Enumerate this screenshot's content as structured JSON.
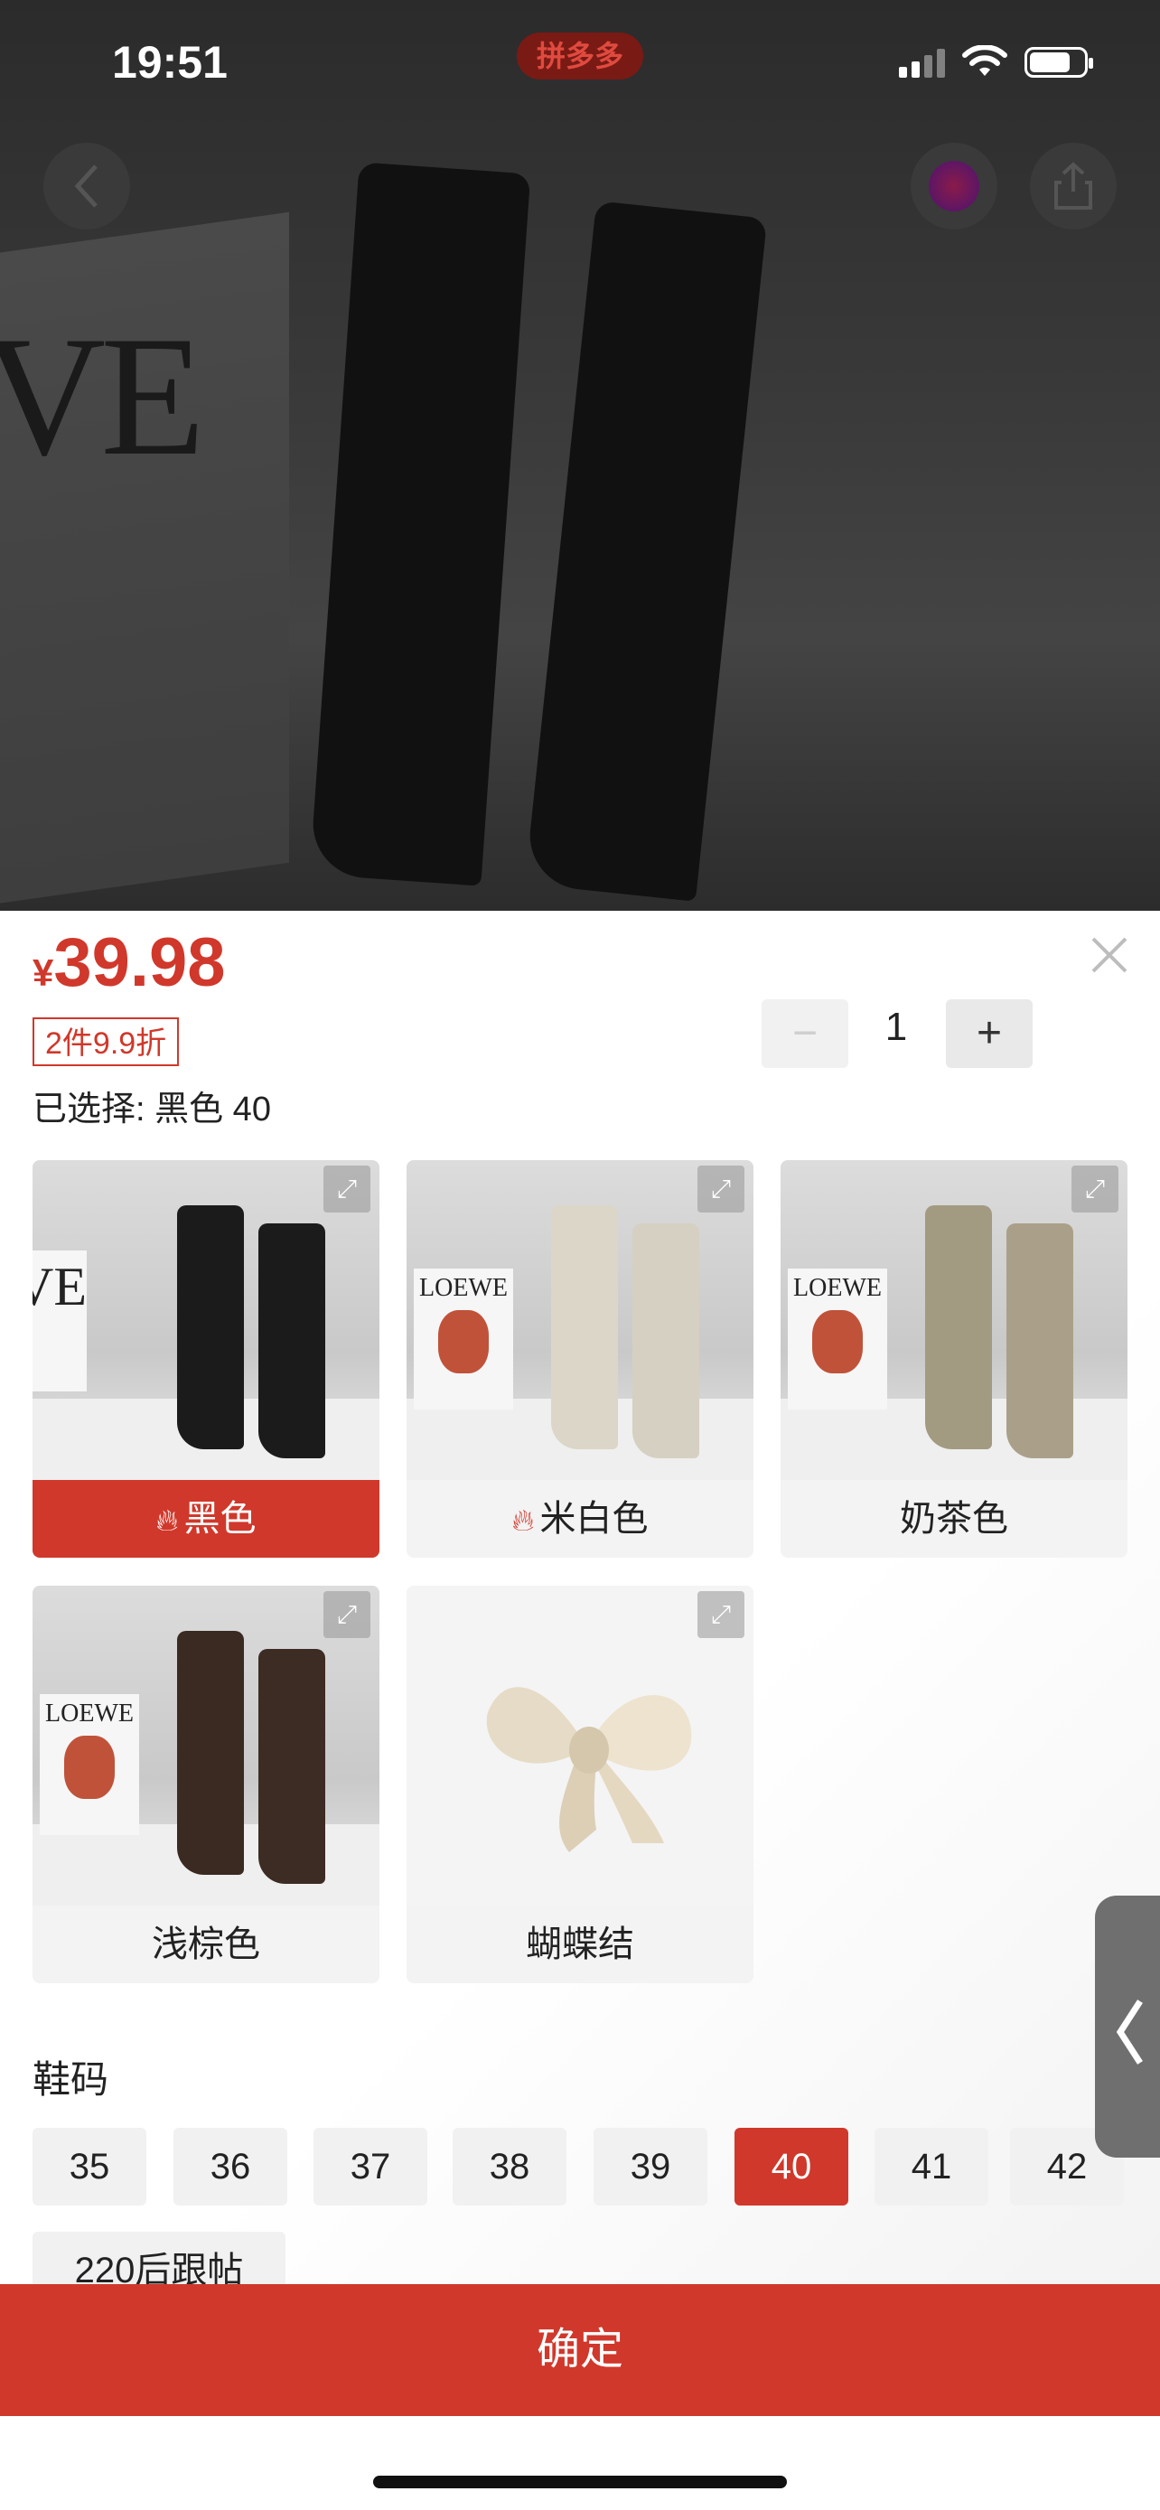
{
  "status_bar": {
    "time": "19:51",
    "app_badge": "拼多多"
  },
  "product": {
    "currency": "¥",
    "price": "39.98",
    "promo": "2件9.9折",
    "selected_prefix": "已选择: ",
    "selected_value": "黑色 40"
  },
  "quantity": {
    "minus": "−",
    "value": "1",
    "plus": "+"
  },
  "color_options": [
    {
      "label": "黑色",
      "hot": true,
      "active": true,
      "boot_color": "#1b1b1b"
    },
    {
      "label": "米白色",
      "hot": true,
      "active": false,
      "boot_color": "#dcd6c8"
    },
    {
      "label": "奶茶色",
      "hot": false,
      "active": false,
      "boot_color": "#a39a82"
    },
    {
      "label": "浅棕色",
      "hot": false,
      "active": false,
      "boot_color": "#3a2a22"
    },
    {
      "label": "蝴蝶结",
      "hot": false,
      "active": false,
      "boot_color": "#e7dcc8"
    }
  ],
  "size_section": {
    "title": "鞋码",
    "sizes": [
      "35",
      "36",
      "37",
      "38",
      "39",
      "40",
      "41",
      "42"
    ],
    "selected": "40",
    "extra_option": "220后跟帖"
  },
  "backdrop_text": "VE",
  "book_text": "LOEWE",
  "confirm_label": "确定",
  "colors": {
    "accent": "#d0382b"
  }
}
